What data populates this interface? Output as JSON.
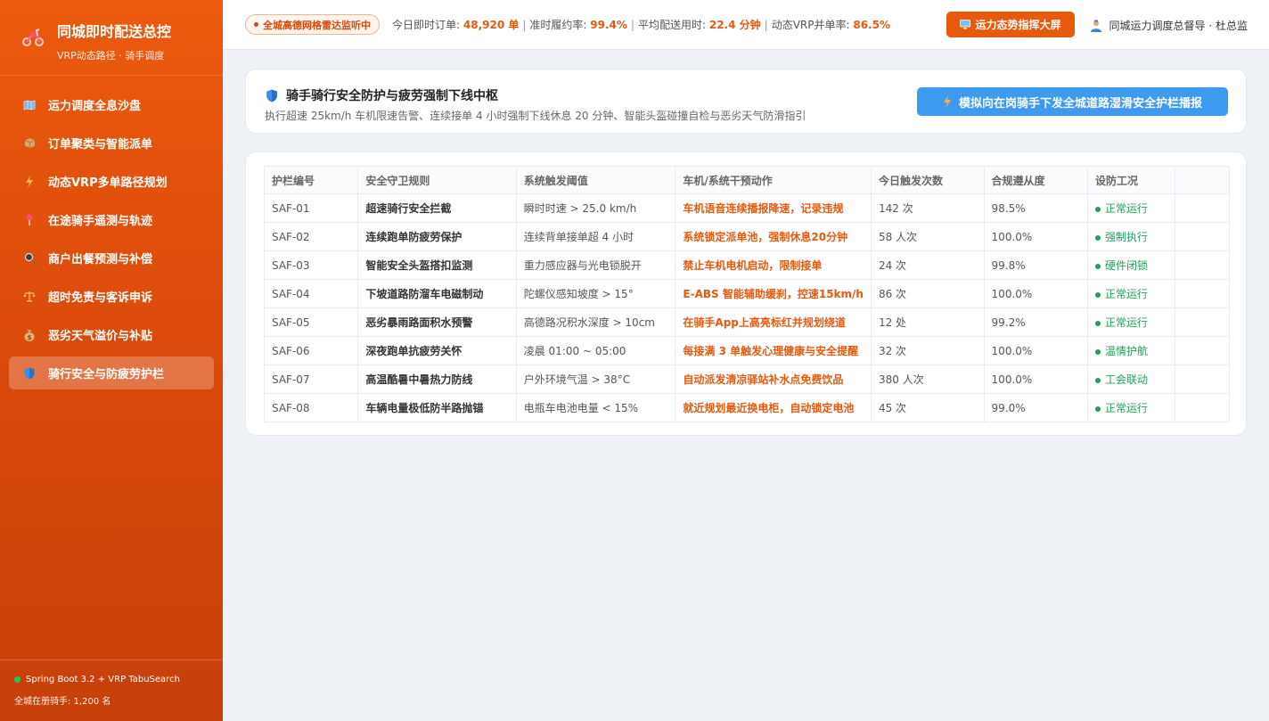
{
  "brand": {
    "title": "同城即时配送总控",
    "subtitle": "VRP动态路径 · 骑手调度"
  },
  "sidebar": {
    "items": [
      {
        "label": "运力调度全息沙盘",
        "icon": "map-icon"
      },
      {
        "label": "订单聚类与智能派单",
        "icon": "package-icon"
      },
      {
        "label": "动态VRP多单路径规划",
        "icon": "lightning-icon"
      },
      {
        "label": "在途骑手遥测与轨迹",
        "icon": "pin-icon"
      },
      {
        "label": "商户出餐预测与补偿",
        "icon": "magnifier-icon"
      },
      {
        "label": "超时免责与客诉申诉",
        "icon": "scale-icon"
      },
      {
        "label": "恶劣天气溢价与补贴",
        "icon": "money-bag-icon"
      },
      {
        "label": "骑行安全与防疲劳护栏",
        "icon": "shield-icon",
        "active": true
      }
    ],
    "footer": {
      "tech": "Spring Boot 3.2 + VRP TabuSearch",
      "riders": "全城在册骑手: 1,200 名"
    }
  },
  "header": {
    "radar": "全城高德网格雷达监听中",
    "kpis": {
      "orders_label": "今日即时订单:",
      "orders_value": "48,920 单",
      "ontime_label": "准时履约率:",
      "ontime_value": "99.4%",
      "avg_label": "平均配送用时:",
      "avg_value": "22.4 分钟",
      "vrp_label": "动态VRP并单率:",
      "vrp_value": "86.5%"
    },
    "screen_button": "运力态势指挥大屏",
    "user": "同城运力调度总督导 · 杜总监"
  },
  "panel": {
    "title": "骑手骑行安全防护与疲劳强制下线中枢",
    "desc": "执行超速 25km/h 车机限速告警、连续接单 4 小时强制下线休息 20 分钟、智能头盔碰撞自检与恶劣天气防滑指引",
    "simulate_button": "模拟向在岗骑手下发全城道路湿滑安全护栏播报"
  },
  "table": {
    "headers": [
      "护栏编号",
      "安全守卫规则",
      "系统触发阈值",
      "车机/系统干预动作",
      "今日触发次数",
      "合规遵从度",
      "设防工况"
    ],
    "rows": [
      [
        "SAF-01",
        "超速骑行安全拦截",
        "瞬时时速 > 25.0 km/h",
        "车机语音连续播报降速，记录违规",
        "142 次",
        "98.5%",
        "正常运行"
      ],
      [
        "SAF-02",
        "连续跑单防疲劳保护",
        "连续背单接单超 4 小时",
        "系统锁定派单池，强制休息20分钟",
        "58 人次",
        "100.0%",
        "强制执行"
      ],
      [
        "SAF-03",
        "智能安全头盔搭扣监测",
        "重力感应器与光电锁脱开",
        "禁止车机电机启动，限制接单",
        "24 次",
        "99.8%",
        "硬件闭锁"
      ],
      [
        "SAF-04",
        "下坡道路防溜车电磁制动",
        "陀螺仪感知坡度 > 15°",
        "E-ABS 智能辅助缓刹，控速15km/h",
        "86 次",
        "100.0%",
        "正常运行"
      ],
      [
        "SAF-05",
        "恶劣暴雨路面积水预警",
        "高德路况积水深度 > 10cm",
        "在骑手App上高亮标红并规划绕道",
        "12 处",
        "99.2%",
        "正常运行"
      ],
      [
        "SAF-06",
        "深夜跑单抗疲劳关怀",
        "凌晨 01:00 ~ 05:00",
        "每接满 3 单触发心理健康与安全提醒",
        "32 次",
        "100.0%",
        "温情护航"
      ],
      [
        "SAF-07",
        "高温酷暑中暑热力防线",
        "户外环境气温 > 38°C",
        "自动派发清凉驿站补水点免费饮品",
        "380 人次",
        "100.0%",
        "工会联动"
      ],
      [
        "SAF-08",
        "车辆电量极低防半路抛锚",
        "电瓶车电池电量 < 15%",
        "就近规划最近换电柜，自动锁定电池",
        "45 次",
        "99.0%",
        "正常运行"
      ]
    ]
  }
}
